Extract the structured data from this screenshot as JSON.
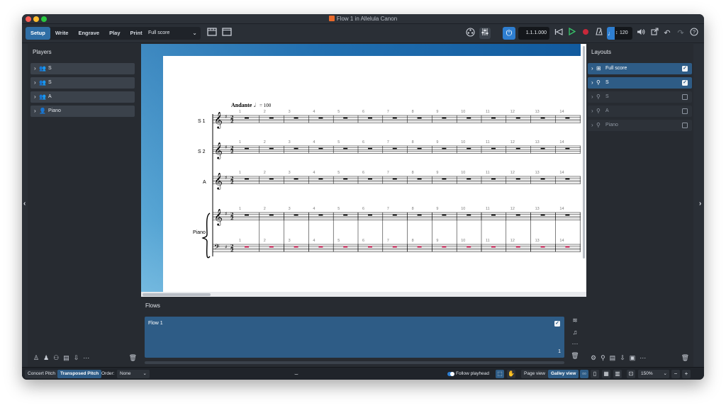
{
  "window": {
    "title": "Flow 1 in Allelula Canon"
  },
  "toolbar": {
    "modes": [
      "Setup",
      "Write",
      "Engrave",
      "Play",
      "Print"
    ],
    "active_mode": "Setup",
    "layout_select": "Full score",
    "transport_position": "1.1.1.000",
    "tempo": "120"
  },
  "players_panel": {
    "header": "Players",
    "players": [
      {
        "label": "S",
        "icon": "ensemble-icon"
      },
      {
        "label": "S",
        "icon": "ensemble-icon"
      },
      {
        "label": "A",
        "icon": "ensemble-icon"
      },
      {
        "label": "Piano",
        "icon": "player-icon"
      }
    ]
  },
  "layouts_panel": {
    "header": "Layouts",
    "layouts": [
      {
        "label": "Full score",
        "checked": true,
        "selected": true
      },
      {
        "label": "S",
        "checked": true,
        "selected": true
      },
      {
        "label": "S",
        "checked": false,
        "selected": false
      },
      {
        "label": "A",
        "checked": false,
        "selected": false
      },
      {
        "label": "Piano",
        "checked": false,
        "selected": false
      }
    ]
  },
  "score": {
    "tempo_text": "Andante",
    "tempo_value": "= 100",
    "staves": [
      "S 1",
      "S 2",
      "A",
      "Piano"
    ],
    "bar_numbers": [
      "1",
      "2",
      "3",
      "4",
      "5",
      "6",
      "7",
      "8",
      "9",
      "10",
      "11",
      "12",
      "13",
      "14"
    ]
  },
  "flows_panel": {
    "header": "Flows",
    "flows": [
      {
        "title": "Flow 1",
        "number": "1",
        "checked": true
      }
    ]
  },
  "statusbar": {
    "concert_pitch": "Concert Pitch",
    "transposed_pitch": "Transposed Pitch",
    "order_label": "Order:",
    "order_value": "None",
    "follow_playhead": "Follow playhead",
    "page_view": "Page view",
    "galley_view": "Galley view",
    "zoom": "150%"
  },
  "colors": {
    "accent": "#2e7ed0",
    "selection": "#2e5c86",
    "rest_red": "#e0245e"
  }
}
